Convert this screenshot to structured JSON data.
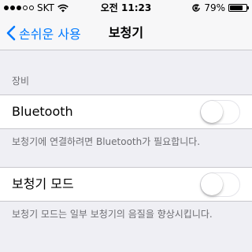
{
  "status_bar": {
    "carrier": "SKT",
    "time": "오전 11:23",
    "battery_text": "79%",
    "battery_level": 0.79,
    "signal_bars_filled": 3,
    "signal_bars_total": 5
  },
  "nav": {
    "back_label": "손쉬운 사용",
    "title": "보청기"
  },
  "section": {
    "header": "장비",
    "bluetooth_label": "Bluetooth",
    "bluetooth_on": false,
    "bluetooth_footer": "보청기에 연결하려면 Bluetooth가 필요합니다.",
    "hearing_mode_label": "보청기 모드",
    "hearing_mode_on": false,
    "hearing_mode_footer": "보청기 모드는 일부 보청기의 음질을 향상시킵니다."
  },
  "colors": {
    "accent": "#007aff",
    "background": "#efeff4",
    "secondary_text": "#6d6d72"
  }
}
